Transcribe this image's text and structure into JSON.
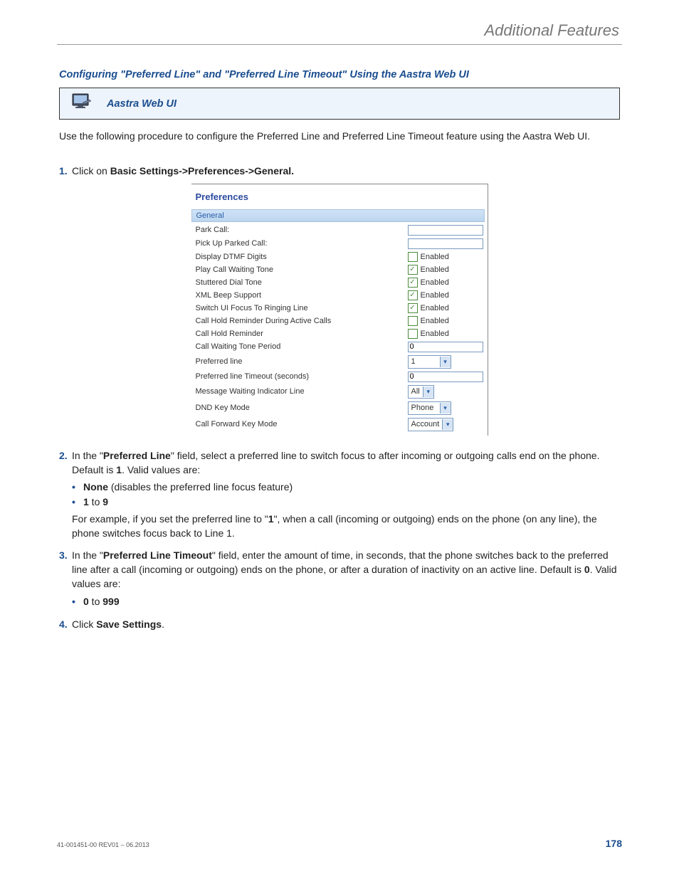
{
  "header": {
    "title": "Additional Features"
  },
  "section": {
    "title": "Configuring \"Preferred Line\" and \"Preferred Line Timeout\" Using the Aastra Web UI",
    "webui_label": "Aastra Web UI",
    "intro": "Use the following procedure to configure the Preferred Line and Preferred Line Timeout feature using the Aastra Web UI."
  },
  "steps": {
    "s1": {
      "num": "1.",
      "pre": "Click on ",
      "bold": "Basic Settings->Preferences->General."
    },
    "s2": {
      "num": "2.",
      "p1a": "In the \"",
      "p1b": "Preferred Line",
      "p1c": "\" field, select a preferred line to switch focus to after incoming or outgoing calls end on the phone. Default is ",
      "p1d": "1",
      "p1e": ". Valid values are:",
      "b1a": "None",
      "b1b": " (disables the preferred line focus feature)",
      "b2a": "1",
      "b2b": " to ",
      "b2c": "9",
      "p2a": "For example, if you set the preferred line to \"",
      "p2b": "1",
      "p2c": "\", when a call (incoming or outgoing) ends on the phone (on any line), the phone switches focus back to Line 1."
    },
    "s3": {
      "num": "3.",
      "p1a": "In the \"",
      "p1b": "Preferred Line Timeout",
      "p1c": "\" field, enter the amount of time, in seconds, that the phone switches back to the preferred line after a call (incoming or outgoing) ends on the phone, or after a duration of inactivity on an active line. Default is ",
      "p1d": "0",
      "p1e": ". Valid values are:",
      "b1a": "0",
      "b1b": " to ",
      "b1c": "999"
    },
    "s4": {
      "num": "4.",
      "pre": "Click ",
      "bold": "Save Settings",
      "post": "."
    }
  },
  "prefs": {
    "title": "Preferences",
    "general": "General",
    "rows": {
      "park": "Park Call:",
      "pickup": "Pick Up Parked Call:",
      "dtmf": "Display DTMF Digits",
      "cwt": "Play Call Waiting Tone",
      "sdt": "Stuttered Dial Tone",
      "xml": "XML Beep Support",
      "ring": "Switch UI Focus To Ringing Line",
      "chrd": "Call Hold Reminder During Active Calls",
      "chr": "Call Hold Reminder",
      "cwtp": "Call Waiting Tone Period",
      "pl": "Preferred line",
      "plt": "Preferred line Timeout (seconds)",
      "mwi": "Message Waiting Indicator Line",
      "dnd": "DND Key Mode",
      "cfkm": "Call Forward Key Mode"
    },
    "enabled": "Enabled",
    "values": {
      "cwtp": "0",
      "pl": "1",
      "plt": "0",
      "mwi": "All",
      "dnd": "Phone",
      "cfkm": "Account"
    }
  },
  "footer": {
    "left": "41-001451-00 REV01 – 06.2013",
    "page": "178"
  }
}
